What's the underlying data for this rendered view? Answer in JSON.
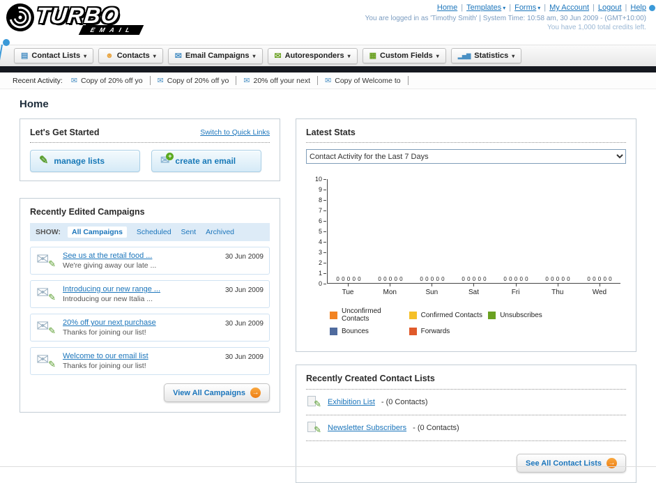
{
  "header": {
    "logo_text": "TURBO",
    "logo_sub": "EMAIL",
    "links": [
      {
        "label": "Home",
        "caret": false
      },
      {
        "label": "Templates",
        "caret": true
      },
      {
        "label": "Forms",
        "caret": true
      },
      {
        "label": "My Account",
        "caret": false
      },
      {
        "label": "Logout",
        "caret": false
      },
      {
        "label": "Help",
        "caret": false
      }
    ],
    "login_line": "You are logged in as 'Timothy Smith' | System Time: 10:58 am, 30 Jun 2009 - (GMT+10:00)",
    "credits_line": "You have 1,000 total credits left."
  },
  "nav": {
    "tabs": [
      {
        "label": "Contact Lists",
        "icon": "contact-lists"
      },
      {
        "label": "Contacts",
        "icon": "contacts"
      },
      {
        "label": "Email Campaigns",
        "icon": "email-campaigns"
      },
      {
        "label": "Autoresponders",
        "icon": "autoresponders"
      },
      {
        "label": "Custom Fields",
        "icon": "custom-fields"
      },
      {
        "label": "Statistics",
        "icon": "statistics"
      }
    ]
  },
  "recent_activity": {
    "label": "Recent Activity:",
    "items": [
      "Copy of 20% off yo",
      "Copy of 20% off yo",
      "20% off your next",
      "Copy of Welcome to"
    ]
  },
  "page": {
    "title": "Home"
  },
  "get_started": {
    "title": "Let's Get Started",
    "switch_link": "Switch to Quick Links",
    "buttons": [
      {
        "label": "manage lists",
        "icon": "pencil"
      },
      {
        "label": "create an email",
        "icon": "envelope-plus"
      }
    ]
  },
  "campaigns": {
    "title": "Recently Edited Campaigns",
    "show_label": "SHOW:",
    "filters": [
      "All Campaigns",
      "Scheduled",
      "Sent",
      "Archived"
    ],
    "active_filter": "All Campaigns",
    "items": [
      {
        "title": "See us at the retail food ...",
        "subtitle": "We're giving away our late ...",
        "date": "30 Jun 2009"
      },
      {
        "title": "Introducing our new range ...",
        "subtitle": "Introducing our new Italia ...",
        "date": "30 Jun 2009"
      },
      {
        "title": "20% off your next purchase",
        "subtitle": "Thanks for joining our list!",
        "date": "30 Jun 2009"
      },
      {
        "title": "Welcome to our email list",
        "subtitle": "Thanks for joining our list!",
        "date": "30 Jun 2009"
      }
    ],
    "view_all_label": "View All Campaigns"
  },
  "stats": {
    "title": "Latest Stats",
    "dropdown_value": "Contact Activity for the Last 7 Days"
  },
  "chart_data": {
    "type": "bar",
    "title": "Contact Activity for the Last 7 Days",
    "categories": [
      "Tue",
      "Mon",
      "Sun",
      "Sat",
      "Fri",
      "Thu",
      "Wed"
    ],
    "series": [
      {
        "name": "Unconfirmed Contacts",
        "color": "#f28322",
        "values": [
          0,
          0,
          0,
          0,
          0,
          0,
          0
        ]
      },
      {
        "name": "Confirmed Contacts",
        "color": "#f5c028",
        "values": [
          0,
          0,
          0,
          0,
          0,
          0,
          0
        ]
      },
      {
        "name": "Unsubscribes",
        "color": "#6aa121",
        "values": [
          0,
          0,
          0,
          0,
          0,
          0,
          0
        ]
      },
      {
        "name": "Bounces",
        "color": "#4f6b9e",
        "values": [
          0,
          0,
          0,
          0,
          0,
          0,
          0
        ]
      },
      {
        "name": "Forwards",
        "color": "#e05a2b",
        "values": [
          0,
          0,
          0,
          0,
          0,
          0,
          0
        ]
      }
    ],
    "xlabel": "",
    "ylabel": "",
    "ylim": [
      0,
      10
    ],
    "ytick_step": 1,
    "grid": false,
    "legend_position": "bottom",
    "value_labels_shown": true
  },
  "contact_lists": {
    "title": "Recently Created Contact Lists",
    "items": [
      {
        "name": "Exhibition List",
        "suffix": "- (0 Contacts)"
      },
      {
        "name": "Newsletter Subscribers",
        "suffix": "- (0 Contacts)"
      }
    ],
    "see_all_label": "See All Contact Lists"
  },
  "colors": {
    "link_blue": "#1b75bb",
    "accent_orange": "#f7941d",
    "dark_strip": "#15181f",
    "panel_border": "#c3cdd5",
    "filter_bar_bg": "#ddebf7"
  }
}
